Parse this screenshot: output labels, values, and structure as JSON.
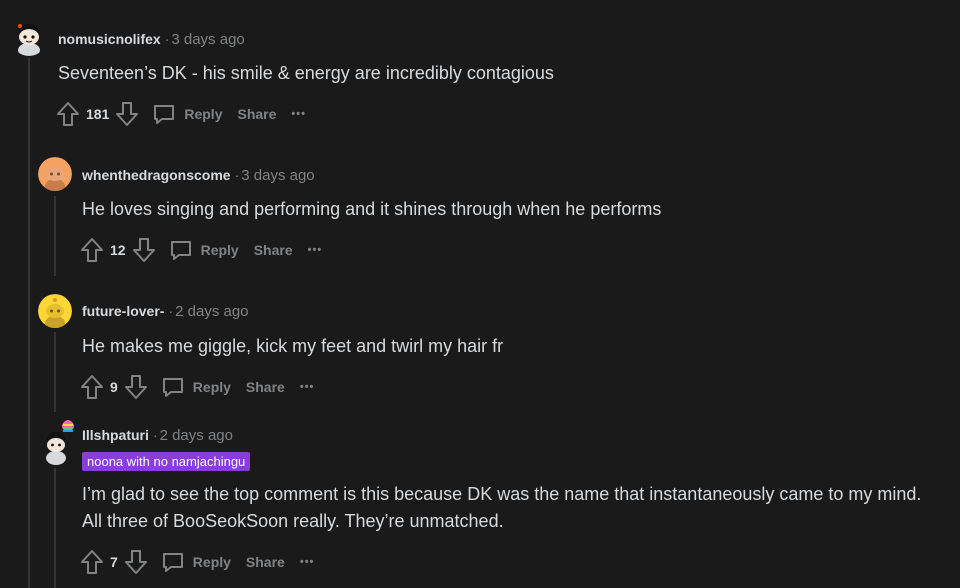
{
  "comments": [
    {
      "username": "nomusicnolifex",
      "time": "3 days ago",
      "text": "Seventeen’s DK - his smile & energy are incredibly contagious",
      "votes": "181",
      "reply_label": "Reply",
      "share_label": "Share",
      "more_label": "•••"
    },
    {
      "username": "whenthedragonscome",
      "time": "3 days ago",
      "text": "He loves singing and performing and it shines through when he performs",
      "votes": "12",
      "reply_label": "Reply",
      "share_label": "Share",
      "more_label": "•••"
    },
    {
      "username": "future-lover-",
      "time": "2 days ago",
      "text": "He makes me giggle, kick my feet and twirl my hair fr",
      "votes": "9",
      "reply_label": "Reply",
      "share_label": "Share",
      "more_label": "•••"
    },
    {
      "username": "Illshpaturi",
      "time": "2 days ago",
      "flair": "noona with no namjachingu",
      "text_line1": "I’m glad to see the top comment is this because DK was the name that instantaneously came to my mind.",
      "text_line2": "All three of BooSeokSoon really. They’re unmatched.",
      "votes": "7",
      "reply_label": "Reply",
      "share_label": "Share",
      "more_label": "•••"
    }
  ],
  "separator": "·",
  "colors": {
    "background": "#1a1a1b",
    "text": "#d7dadc",
    "muted": "#818384",
    "thread_line": "#343536",
    "flair_bg": "#8a3dd9"
  }
}
